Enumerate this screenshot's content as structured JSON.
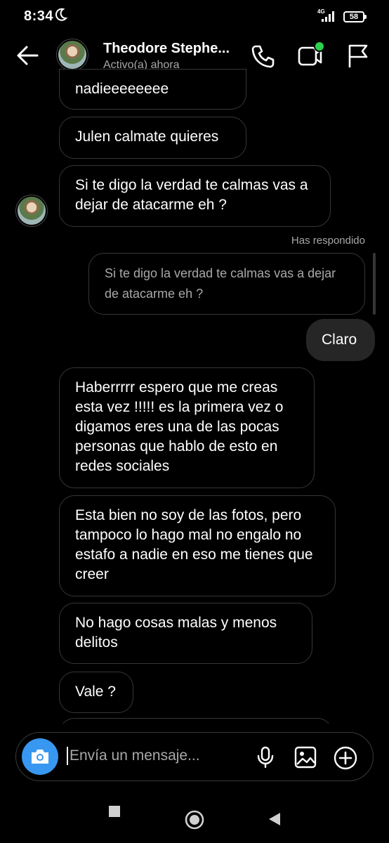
{
  "status_bar": {
    "time": "8:34",
    "network": "4G",
    "battery": "58"
  },
  "header": {
    "name": "Theodore Stephe...",
    "status": "Activo(a) ahora"
  },
  "messages": {
    "m0": "nadieeeeeeee",
    "m1": "Julen calmate quieres",
    "m2": "Si te digo la verdad te calmas vas a dejar de atacarme eh ?",
    "replied_label": "Has respondido",
    "quoted": "Si te digo la verdad te calmas vas a dejar de atacarme eh ?",
    "sent": "Claro",
    "m3": "Haberrrrr espero que me creas esta vez !!!!! es la primera vez o digamos eres una de las pocas personas que hablo de esto en redes sociales",
    "m4": "Esta bien no soy de las fotos, pero tampoco lo hago mal no engalo no estafo a nadie en eso me tienes que creer",
    "m5": "No hago cosas malas y menos delitos",
    "m6": "Vale ?"
  },
  "composer": {
    "placeholder": "Envía un mensaje..."
  },
  "colors": {
    "accent": "#3897f0",
    "online": "#2bd14f",
    "sent_bubble": "#262626"
  }
}
